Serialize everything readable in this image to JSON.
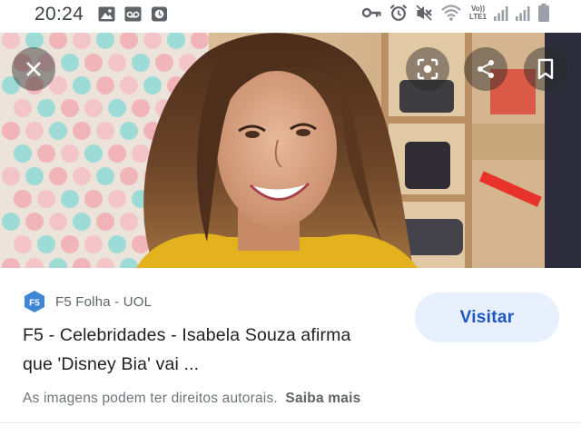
{
  "status_bar": {
    "time": "20:24",
    "left_icons": [
      "gallery-icon",
      "voicemail-icon",
      "clock-app-icon"
    ],
    "right_icons": [
      "key-icon",
      "alarm-icon",
      "mute-icon",
      "wifi-icon",
      "volte-icon",
      "signal-icon",
      "signal-icon",
      "battery-icon"
    ],
    "volte_label_top": "Vo))",
    "volte_label_bottom": "LTE1"
  },
  "image_viewer": {
    "buttons": [
      "close-icon",
      "lens-icon",
      "share-icon",
      "bookmark-icon"
    ]
  },
  "result": {
    "source": "F5 Folha - UOL",
    "source_logo_text": "F5",
    "title_line1": "F5 - Celebridades - Isabela Souza afirma",
    "title_line2": "que 'Disney Bia' vai ...",
    "visit_label": "Visitar",
    "rights_text": "As imagens podem ter direitos autorais.",
    "learn_more": "Saiba mais"
  },
  "colors": {
    "visit_bg": "#e8f0fe",
    "visit_text": "#1a56c4",
    "logo_blue": "#3d86d8"
  }
}
